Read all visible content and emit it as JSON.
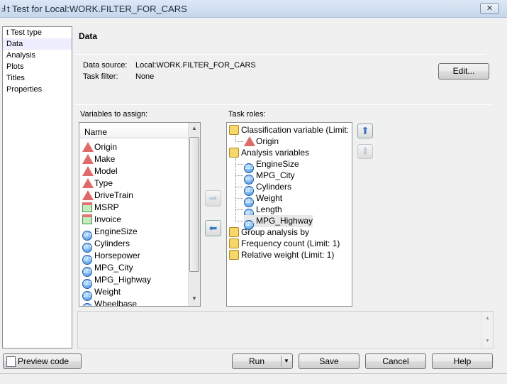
{
  "window": {
    "title": "t Test for Local:WORK.FILTER_FOR_CARS",
    "close": "✕"
  },
  "nav": [
    "t Test type",
    "Data",
    "Analysis",
    "Plots",
    "Titles",
    "Properties"
  ],
  "section_title": "Data",
  "data_source": {
    "label": "Data source:",
    "value": "Local:WORK.FILTER_FOR_CARS"
  },
  "task_filter": {
    "label": "Task filter:",
    "value": "None"
  },
  "edit_label": "Edit...",
  "variables": {
    "label": "Variables to assign:",
    "header": "Name",
    "items": [
      {
        "name": "Origin",
        "type": "char"
      },
      {
        "name": "Make",
        "type": "char"
      },
      {
        "name": "Model",
        "type": "char"
      },
      {
        "name": "Type",
        "type": "char"
      },
      {
        "name": "DriveTrain",
        "type": "char"
      },
      {
        "name": "MSRP",
        "type": "currency"
      },
      {
        "name": "Invoice",
        "type": "currency"
      },
      {
        "name": "EngineSize",
        "type": "numeric"
      },
      {
        "name": "Cylinders",
        "type": "numeric"
      },
      {
        "name": "Horsepower",
        "type": "numeric"
      },
      {
        "name": "MPG_City",
        "type": "numeric"
      },
      {
        "name": "MPG_Highway",
        "type": "numeric"
      },
      {
        "name": "Weight",
        "type": "numeric"
      },
      {
        "name": "Wheelbase",
        "type": "numeric"
      }
    ]
  },
  "roles": {
    "label": "Task roles:",
    "items": [
      {
        "name": "Classification variable  (Limit: 1)",
        "level": 0,
        "type": "role-class"
      },
      {
        "name": "Origin",
        "level": 1,
        "type": "char"
      },
      {
        "name": "Analysis variables",
        "level": 0,
        "type": "role"
      },
      {
        "name": "EngineSize",
        "level": 1,
        "type": "numeric"
      },
      {
        "name": "MPG_City",
        "level": 1,
        "type": "numeric"
      },
      {
        "name": "Cylinders",
        "level": 1,
        "type": "numeric"
      },
      {
        "name": "Weight",
        "level": 1,
        "type": "numeric"
      },
      {
        "name": "Length",
        "level": 1,
        "type": "numeric"
      },
      {
        "name": "MPG_Highway",
        "level": 1,
        "type": "numeric",
        "selected": true
      },
      {
        "name": "Group analysis by",
        "level": 0,
        "type": "role-class"
      },
      {
        "name": "Frequency count  (Limit: 1)",
        "level": 0,
        "type": "role"
      },
      {
        "name": "Relative weight  (Limit: 1)",
        "level": 0,
        "type": "role"
      }
    ]
  },
  "buttons": {
    "preview": "Preview code",
    "run": "Run",
    "save": "Save",
    "cancel": "Cancel",
    "help": "Help"
  }
}
